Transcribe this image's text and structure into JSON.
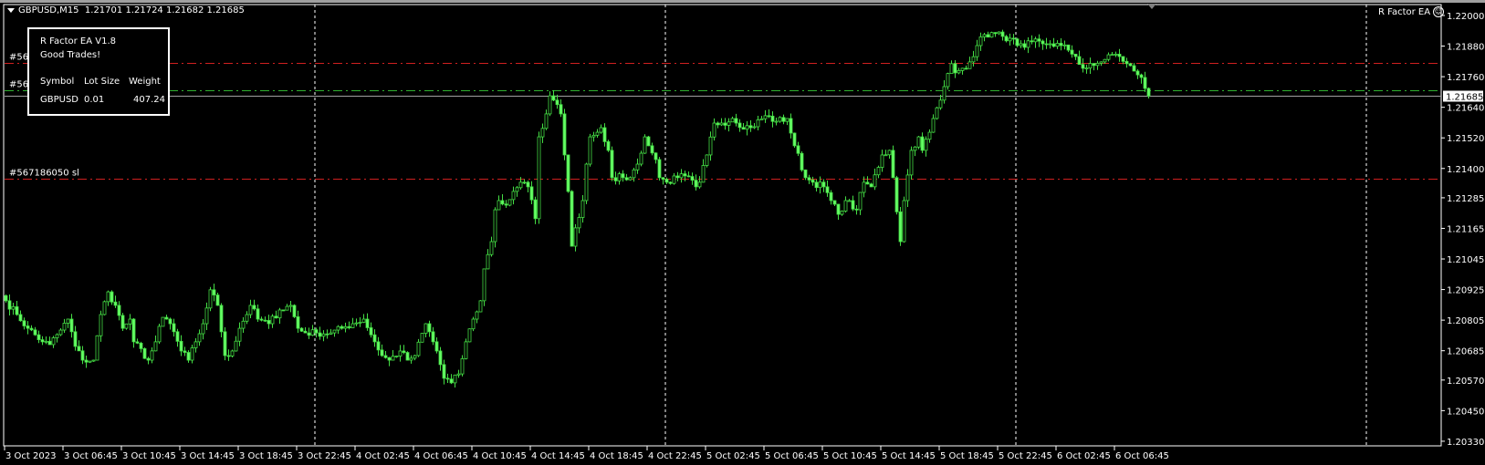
{
  "header": {
    "symbol_timeframe": "GBPUSD,M15",
    "ohlc": "1.21701 1.21724 1.21682 1.21685",
    "ea_label": "R Factor EA",
    "ea_icon": "smiley-icon"
  },
  "panel": {
    "title": "R Factor EA V1.8",
    "subtitle": "Good Trades!",
    "columns": [
      "Symbol",
      "Lot Size",
      "Weight"
    ],
    "row": [
      "GBPUSD",
      "0.01",
      "407.24"
    ]
  },
  "order_lines": [
    {
      "label": "#56",
      "price": 1.21813,
      "color": "#d02020"
    },
    {
      "label": "#56",
      "price": 1.21705,
      "color": "#30b030"
    },
    {
      "label": "#567186050 sl",
      "price": 1.2136,
      "color": "#d02020"
    }
  ],
  "colors": {
    "candle": "#44dd44",
    "candle_bear_fill": "#66ff66",
    "bid_line": "#a0a0a0"
  },
  "chart_data": {
    "type": "candlestick",
    "symbol": "GBPUSD",
    "timeframe": "M15",
    "current_price": 1.21685,
    "ylim": [
      1.2033,
      1.22
    ],
    "y_ticks": [
      "1.22000",
      "1.21880",
      "1.21760",
      "1.21640",
      "1.21520",
      "1.21400",
      "1.21285",
      "1.21165",
      "1.21045",
      "1.20925",
      "1.20805",
      "1.20685",
      "1.20570",
      "1.20450",
      "1.20330"
    ],
    "x_ticks": [
      "3 Oct 2023",
      "3 Oct 06:45",
      "3 Oct 10:45",
      "3 Oct 14:45",
      "3 Oct 18:45",
      "3 Oct 22:45",
      "4 Oct 02:45",
      "4 Oct 06:45",
      "4 Oct 10:45",
      "4 Oct 14:45",
      "4 Oct 18:45",
      "4 Oct 22:45",
      "5 Oct 02:45",
      "5 Oct 06:45",
      "5 Oct 10:45",
      "5 Oct 14:45",
      "5 Oct 18:45",
      "5 Oct 22:45",
      "6 Oct 02:45",
      "6 Oct 06:45"
    ],
    "bars_per_tick": 16,
    "bar_count": 314,
    "day_separator_bars": [
      85,
      181,
      277,
      373
    ],
    "close_keypoints": [
      [
        0,
        1.20881
      ],
      [
        3,
        1.20827
      ],
      [
        6,
        1.20773
      ],
      [
        10,
        1.2072
      ],
      [
        12,
        1.20709
      ],
      [
        15,
        1.20766
      ],
      [
        17,
        1.20809
      ],
      [
        19,
        1.20702
      ],
      [
        21,
        1.20648
      ],
      [
        24,
        1.20648
      ],
      [
        26,
        1.20827
      ],
      [
        28,
        1.20916
      ],
      [
        30,
        1.20863
      ],
      [
        32,
        1.20773
      ],
      [
        34,
        1.20809
      ],
      [
        35,
        1.2072
      ],
      [
        39,
        1.20648
      ],
      [
        41,
        1.2072
      ],
      [
        43,
        1.20816
      ],
      [
        45,
        1.20791
      ],
      [
        48,
        1.20684
      ],
      [
        50,
        1.20648
      ],
      [
        52,
        1.2072
      ],
      [
        54,
        1.20791
      ],
      [
        56,
        1.20924
      ],
      [
        58,
        1.20863
      ],
      [
        60,
        1.20666
      ],
      [
        62,
        1.20684
      ],
      [
        64,
        1.20773
      ],
      [
        67,
        1.20863
      ],
      [
        69,
        1.20809
      ],
      [
        72,
        1.20791
      ],
      [
        75,
        1.20845
      ],
      [
        78,
        1.20863
      ],
      [
        80,
        1.20773
      ],
      [
        82,
        1.20755
      ],
      [
        85,
        1.20755
      ],
      [
        89,
        1.20755
      ],
      [
        92,
        1.20773
      ],
      [
        95,
        1.20791
      ],
      [
        98,
        1.20809
      ],
      [
        101,
        1.2072
      ],
      [
        103,
        1.20666
      ],
      [
        105,
        1.20648
      ],
      [
        108,
        1.20684
      ],
      [
        110,
        1.20648
      ],
      [
        112,
        1.20666
      ],
      [
        115,
        1.20791
      ],
      [
        118,
        1.20684
      ],
      [
        120,
        1.20577
      ],
      [
        122,
        1.20559
      ],
      [
        124,
        1.20594
      ],
      [
        126,
        1.2072
      ],
      [
        128,
        1.20809
      ],
      [
        130,
        1.20881
      ],
      [
        131,
        1.21006
      ],
      [
        133,
        1.21113
      ],
      [
        134,
        1.21238
      ],
      [
        135,
        1.21274
      ],
      [
        137,
        1.21256
      ],
      [
        139,
        1.2131
      ],
      [
        141,
        1.21346
      ],
      [
        143,
        1.21328
      ],
      [
        145,
        1.21203
      ],
      [
        146,
        1.21524
      ],
      [
        148,
        1.21614
      ],
      [
        149,
        1.21685
      ],
      [
        150,
        1.21668
      ],
      [
        152,
        1.21614
      ],
      [
        153,
        1.21453
      ],
      [
        154,
        1.2131
      ],
      [
        155,
        1.21095
      ],
      [
        156,
        1.21167
      ],
      [
        158,
        1.21274
      ],
      [
        159,
        1.21417
      ],
      [
        160,
        1.21524
      ],
      [
        162,
        1.21542
      ],
      [
        163,
        1.2156
      ],
      [
        165,
        1.21471
      ],
      [
        166,
        1.21364
      ],
      [
        169,
        1.21364
      ],
      [
        171,
        1.21364
      ],
      [
        173,
        1.21417
      ],
      [
        175,
        1.21524
      ],
      [
        176,
        1.21489
      ],
      [
        178,
        1.21435
      ],
      [
        179,
        1.21364
      ],
      [
        181,
        1.21346
      ],
      [
        184,
        1.21364
      ],
      [
        186,
        1.21371
      ],
      [
        189,
        1.21328
      ],
      [
        190,
        1.21346
      ],
      [
        192,
        1.21453
      ],
      [
        194,
        1.21578
      ],
      [
        196,
        1.21578
      ],
      [
        199,
        1.21596
      ],
      [
        200,
        1.21578
      ],
      [
        204,
        1.2156
      ],
      [
        208,
        1.21607
      ],
      [
        211,
        1.21585
      ],
      [
        214,
        1.21596
      ],
      [
        216,
        1.21489
      ],
      [
        219,
        1.21364
      ],
      [
        221,
        1.21346
      ],
      [
        224,
        1.21328
      ],
      [
        226,
        1.21274
      ],
      [
        228,
        1.2122
      ],
      [
        230,
        1.21274
      ],
      [
        233,
        1.21238
      ],
      [
        235,
        1.21346
      ],
      [
        237,
        1.21328
      ],
      [
        240,
        1.21453
      ],
      [
        242,
        1.21471
      ],
      [
        243,
        1.21364
      ],
      [
        245,
        1.21113
      ],
      [
        246,
        1.21274
      ],
      [
        248,
        1.21471
      ],
      [
        250,
        1.21524
      ],
      [
        251,
        1.21471
      ],
      [
        253,
        1.21542
      ],
      [
        254,
        1.21596
      ],
      [
        256,
        1.21668
      ],
      [
        257,
        1.21721
      ],
      [
        259,
        1.21811
      ],
      [
        260,
        1.21775
      ],
      [
        262,
        1.21793
      ],
      [
        264,
        1.21818
      ],
      [
        266,
        1.21882
      ],
      [
        268,
        1.21925
      ],
      [
        271,
        1.21929
      ],
      [
        273,
        1.21918
      ],
      [
        275,
        1.21911
      ],
      [
        277,
        1.21882
      ],
      [
        279,
        1.21875
      ],
      [
        281,
        1.21897
      ],
      [
        284,
        1.21889
      ],
      [
        286,
        1.21889
      ],
      [
        289,
        1.21882
      ],
      [
        291,
        1.21864
      ],
      [
        293,
        1.21839
      ],
      [
        295,
        1.21793
      ],
      [
        298,
        1.21804
      ],
      [
        300,
        1.21818
      ],
      [
        302,
        1.21846
      ],
      [
        305,
        1.21839
      ],
      [
        307,
        1.21811
      ],
      [
        309,
        1.21782
      ],
      [
        311,
        1.21757
      ],
      [
        312,
        1.21714
      ],
      [
        313,
        1.21685
      ]
    ]
  }
}
